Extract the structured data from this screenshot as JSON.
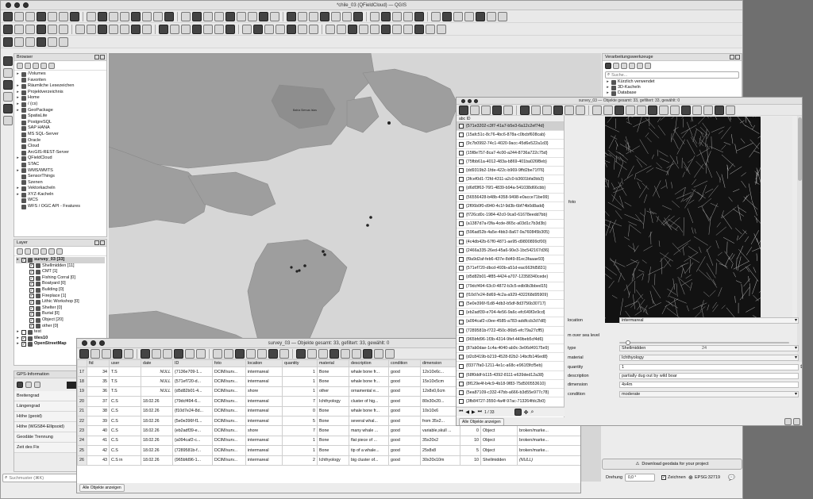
{
  "window": {
    "title": "*chile_03 (QFieldCloud) — QGIS"
  },
  "browser": {
    "title": "Browser",
    "items": [
      {
        "label": "/Volumes",
        "tri": "▸"
      },
      {
        "label": "Favoriten",
        "tri": ""
      },
      {
        "label": "Räumliche Lesezeichen",
        "tri": "▸"
      },
      {
        "label": "Projektverzeichnis",
        "tri": "▸"
      },
      {
        "label": "Home",
        "tri": "▸"
      },
      {
        "label": "/ (cs)",
        "tri": "▸"
      },
      {
        "label": "GeoPackage",
        "tri": "▸"
      },
      {
        "label": "SpatiaLite",
        "tri": ""
      },
      {
        "label": "PostgreSQL",
        "tri": ""
      },
      {
        "label": "SAP HANA",
        "tri": ""
      },
      {
        "label": "MS SQL-Server",
        "tri": ""
      },
      {
        "label": "Oracle",
        "tri": ""
      },
      {
        "label": "Cloud",
        "tri": ""
      },
      {
        "label": "ArcGIS-REST-Server",
        "tri": ""
      },
      {
        "label": "QFieldCloud",
        "tri": "▸"
      },
      {
        "label": "STAC",
        "tri": ""
      },
      {
        "label": "WMS/WMTS",
        "tri": "▸"
      },
      {
        "label": "SensorThings",
        "tri": ""
      },
      {
        "label": "Szenen",
        "tri": ""
      },
      {
        "label": "Vektorkacheln",
        "tri": "▸"
      },
      {
        "label": "XYZ-Kacheln",
        "tri": "▸"
      },
      {
        "label": "WCS",
        "tri": ""
      },
      {
        "label": "WFS / OGC API - Features",
        "tri": ""
      }
    ]
  },
  "layers": {
    "title": "Layer",
    "items": [
      {
        "label": "survey_03 [33]",
        "indent": 0,
        "checked": true,
        "bold": true
      },
      {
        "label": "Shellmidden [11]",
        "indent": 1,
        "checked": true,
        "bold": false
      },
      {
        "label": "CMT [1]",
        "indent": 1,
        "checked": true,
        "bold": false
      },
      {
        "label": "Fishing Corral [0]",
        "indent": 1,
        "checked": true,
        "bold": false
      },
      {
        "label": "Boatyard [0]",
        "indent": 1,
        "checked": true,
        "bold": false
      },
      {
        "label": "Building [0]",
        "indent": 1,
        "checked": true,
        "bold": false
      },
      {
        "label": "Fireplace [1]",
        "indent": 1,
        "checked": true,
        "bold": false
      },
      {
        "label": "Lithic Workshop [0]",
        "indent": 1,
        "checked": true,
        "bold": false
      },
      {
        "label": "Shelter [0]",
        "indent": 1,
        "checked": true,
        "bold": false
      },
      {
        "label": "Burial [0]",
        "indent": 1,
        "checked": true,
        "bold": false
      },
      {
        "label": "Object [20]",
        "indent": 1,
        "checked": true,
        "bold": false
      },
      {
        "label": "other [0]",
        "indent": 1,
        "checked": true,
        "bold": false
      },
      {
        "label": "test",
        "indent": 0,
        "checked": false,
        "bold": false
      },
      {
        "label": "tiles10",
        "indent": 0,
        "checked": true,
        "bold": true
      },
      {
        "label": "OpenStreetMap",
        "indent": 0,
        "checked": true,
        "bold": true
      }
    ]
  },
  "gps": {
    "title": "GPS-Information",
    "rows": [
      "Breitengrad",
      "Längengrad",
      "Höhe (geoid)",
      "Höhe (WGS84-Ellipsoid)",
      "Geodäte Trennung",
      "Zeit des Fix"
    ]
  },
  "search": {
    "placeholder": "Suchmuster (⌘K)"
  },
  "attr_table": {
    "title": "survey_03 — Objekte gesamt: 33, gefiltert: 33, gewählt: 0",
    "columns": [
      "fid",
      "user",
      "date",
      "ID",
      "foto",
      "location",
      "quantity",
      "material",
      "description",
      "condition",
      "dimension",
      "",
      "",
      ""
    ],
    "rows": [
      [
        "17",
        "34",
        "T.S",
        "NULL",
        "{7136e709-1...",
        "DCIM/surv...",
        "intermareal",
        "1",
        "Bone",
        "whale bone fr...",
        "good",
        "12x10x6c...",
        "",
        "",
        ""
      ],
      [
        "18",
        "35",
        "T.S",
        "NULL",
        "{571ef720-d...",
        "DCIM/surv...",
        "intermareal",
        "1",
        "Bone",
        "whale bone fr...",
        "good",
        "15x10x5cm",
        "",
        "",
        ""
      ],
      [
        "19",
        "36",
        "T.S",
        "NULL",
        "{d5d82b01-4...",
        "DCIM/surv...",
        "shore",
        "1",
        "other",
        "ornamental e...",
        "good",
        "12x8x0,6cm",
        "",
        "",
        ""
      ],
      [
        "20",
        "37",
        "C.S",
        "18.02.26",
        "{79dcf494-6...",
        "DCIM/surv...",
        "intermareal",
        "7",
        "Ichthyology",
        "cluster of hig...",
        "good",
        "80x30x20...",
        "",
        "",
        ""
      ],
      [
        "21",
        "38",
        "C.S",
        "18.02.26",
        "{f10d7e24-8d...",
        "DCIM/surv...",
        "intermareal",
        "0",
        "Bone",
        "whale bone fr...",
        "good",
        "10x10x6",
        "",
        "",
        ""
      ],
      [
        "22",
        "39",
        "C.S",
        "18.02.26",
        "{5e0e396f-f1...",
        "DCIM/surv...",
        "intermareal",
        "5",
        "Bone",
        "several whal...",
        "good",
        "from 35x2...",
        "",
        "",
        ""
      ],
      [
        "23",
        "40",
        "C.S",
        "18.02.26",
        "{eb2adf39-e...",
        "DCIM/surv...",
        "shore",
        "7",
        "Bone",
        "many whale ...",
        "good",
        "variable,skull ...",
        "0",
        "Object",
        "broken/marke..."
      ],
      [
        "24",
        "41",
        "C.S",
        "18.02.26",
        "{a094caf2-c...",
        "DCIM/surv...",
        "intermareal",
        "1",
        "Bone",
        "flat piece of ...",
        "good",
        "35x20x2",
        "10",
        "Object",
        "broken/marke..."
      ],
      [
        "25",
        "42",
        "C.S",
        "18.02.26",
        "{7289581b-f...",
        "DCIM/surv...",
        "intermareal",
        "1",
        "Bone",
        "tip of a whale...",
        "good",
        "25x8x8",
        "5",
        "Object",
        "broken/marke..."
      ],
      [
        "26",
        "43",
        "C.S in",
        "18.02.26",
        "{965bfd96-1...",
        "DCIM/surv...",
        "intermareal",
        "2",
        "Ichthyology",
        "big cluster of...",
        "good",
        "30x20x10m",
        "10",
        "Shellmidden",
        "(NULL)"
      ]
    ],
    "show_all": "Alle Objekte anzeigen"
  },
  "form_window": {
    "title": "survey_03 — Objekte gesamt: 33, gefiltert: 33, gewählt: 0",
    "list_header": "abc ID",
    "uuids": [
      "{571e3202-c3f7-41a7-b5e3-6a12c2ef74d}",
      "{15afc51c-8c76-4bc6-878a-c0bcbf608cab}",
      "{9c7b0992-74c1-4020-9acc-45d6e522a1d3}",
      "{15f8e757-8ca7-4c00-a244-8736a722c75d}",
      "{75fbb61a-4012-483a-b869-401ba026f8eb}",
      "{dd9319b2-1fde-422c-b969-9ffd2be71f76}",
      "{3fcef0d1-72fd-4311-a2c0-b3601bfa0bb3}",
      "{d6df3f63-76f1-4839-b94a-541038d66cbb}",
      "{56556428-b48b-4358-9498-e0acce71be99}",
      "{2f06b0f0-d940-4c1f-9d3b-6bf74b0d8add}",
      "{f726cd0c-1984-42c0-9ca0-61678eedd7bb}",
      "{a1387d7a-f3fa-4cde-865c-a03d1c7b3d3b}",
      "{596ad52b-4a5e-4bb3-8a67-9a760845b305}",
      "{4c4db42b-67f0-4871-ae95-d9800899cf00}",
      "{2466a335-26ed-45a6-90e3-1bc542167d36}",
      "{f9a9d2af-feb6-437e-8d49-81ec3faaae93}",
      "{571ef720-dbcd-493b-a51d-eac663fd5831}",
      "{d5d82b01-4f85-4424-a707-12358340cede}",
      "{79dcf494-63c0-4872-b3c5-edb9b3bbed15}",
      "{f10d7e24-8d69-4c2a-a929-432268d95909}",
      "{5e0e396f-f1d8-4db3-b5df-8d3756b30717}",
      "{eb2adf39-e704-4e56-9a6c-efc649f2e9cd}",
      "{a094caf2-c0ee-4585-a783-addfccb2d7d8}",
      "{7289581b-f722-450c-86b5-efc79a27cff5}",
      "{965bfd96-1f3b-4314-9fef-449beb5cf4d6}",
      "{87ab0dae-1c4a-4040-ab9c-3e06d49175e9}",
      "{d2c8419b-b219-4528-82b2-14bcfb146ed8}",
      "{f3377fa0-1211-4e1c-a68c-e961f3fcf5eb}",
      "{68f0ddf-b115-4392-8111-e639ded12a38}",
      "{8f129e4f-b4c9-4b18-9f83-75d500553610}",
      "{5ea87109-c332-47bb-a666-b3d55e977c78}",
      "{3fb84727-3550-4a4f-97ac-713264fdc2b0}"
    ],
    "selected_index": 0,
    "nav_count": "1 / 33",
    "show_all": "Alle Objekte anzeigen",
    "foto_label": "foto",
    "fields": [
      {
        "label": "location",
        "value": "intermareal",
        "combo": true
      },
      {
        "label": "m over sea level",
        "value": "",
        "combo": false
      },
      {
        "label": "type",
        "value": "Shellmidden",
        "combo": true
      },
      {
        "label": "material",
        "value": "Ichthyology",
        "combo": true
      },
      {
        "label": "quantity",
        "value": "1",
        "combo": false
      },
      {
        "label": "description",
        "value": "partially dug out by wild boar",
        "combo": false
      },
      {
        "label": "dimension",
        "value": "4x4m",
        "combo": false
      },
      {
        "label": "condition",
        "value": "moderate",
        "combo": true
      }
    ],
    "slider_value": "24",
    "slider_fraction": 0.04
  },
  "processing": {
    "title": "Verarbeitungswerkzeuge",
    "search_placeholder": "Suche...",
    "items": [
      "Kürzlich verwendet",
      "3D-Kacheln",
      "Database"
    ]
  },
  "map": {
    "label": "Bahía Siervas Islas"
  },
  "statusbar": {
    "download": "Download geodata for your project",
    "rotation_label": "Drehung",
    "rotation_value": "0,0 °",
    "render_label": "Zeichnen",
    "crs": "EPSG:32719"
  }
}
